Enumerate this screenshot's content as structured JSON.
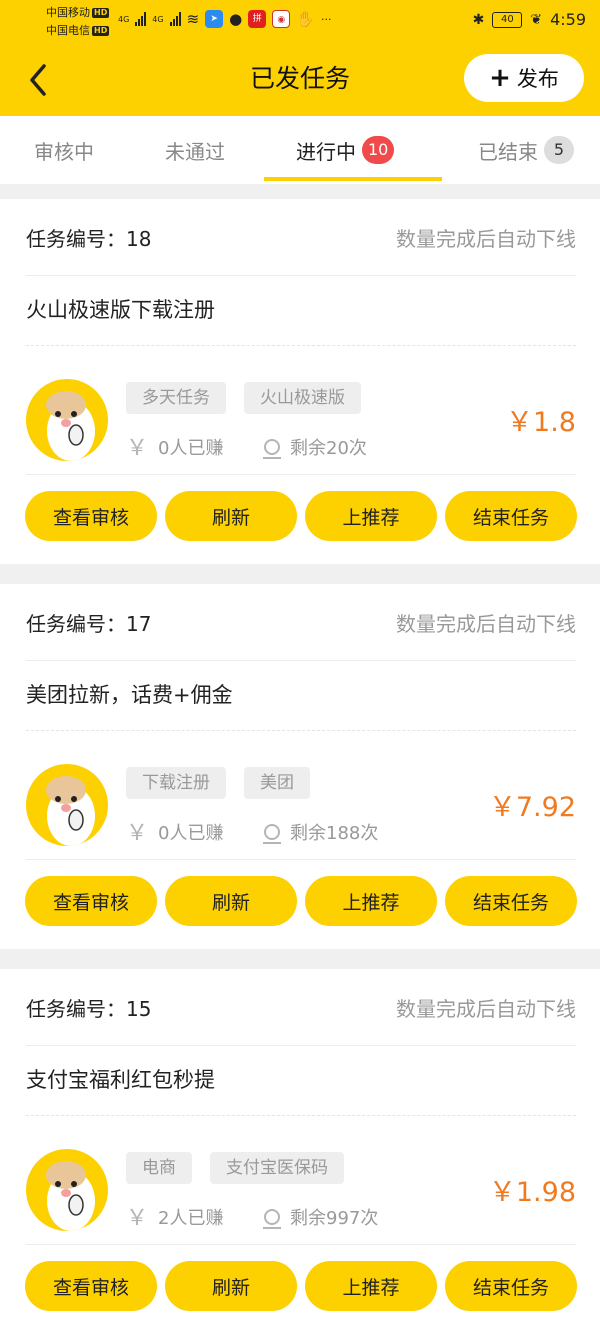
{
  "status_bar": {
    "carrier1": "中国移动",
    "carrier2": "中国电信",
    "hd_label": "HD",
    "network": "4G",
    "app_badges": [
      "拼",
      "···"
    ],
    "battery": "40",
    "time": "4:59"
  },
  "nav": {
    "title": "已发任务",
    "publish_label": "发布",
    "publish_icon": "plus-icon",
    "back_icon": "chevron-left-icon"
  },
  "tabs": [
    {
      "label": "审核中",
      "active": false
    },
    {
      "label": "未通过",
      "active": false
    },
    {
      "label": "进行中",
      "badge": "10",
      "active": true
    },
    {
      "label": "已结束",
      "badge": "5",
      "active": false
    }
  ],
  "tasks": [
    {
      "number_label": "任务编号：18",
      "status": "数量完成后自动下线",
      "title": "火山极速版下载注册",
      "tags": [
        "多天任务",
        "火山极速版"
      ],
      "earned": "0人已赚",
      "remaining": "剩余20次",
      "price": "￥1.8"
    },
    {
      "number_label": "任务编号：17",
      "status": "数量完成后自动下线",
      "title": "美团拉新，话费+佣金",
      "tags": [
        "下载注册",
        "美团"
      ],
      "earned": "0人已赚",
      "remaining": "剩余188次",
      "price": "￥7.92"
    },
    {
      "number_label": "任务编号：15",
      "status": "数量完成后自动下线",
      "title": "支付宝福利红包秒提",
      "tags": [
        "电商",
        "支付宝医保码"
      ],
      "earned": "2人已赚",
      "remaining": "剩余997次",
      "price": "￥1.98"
    }
  ],
  "actions": {
    "review": "查看审核",
    "refresh": "刷新",
    "recommend": "上推荐",
    "end": "结束任务"
  },
  "colors": {
    "brand_yellow": "#fdd000",
    "price_orange": "#f07a20",
    "badge_red": "#f04a4a"
  }
}
